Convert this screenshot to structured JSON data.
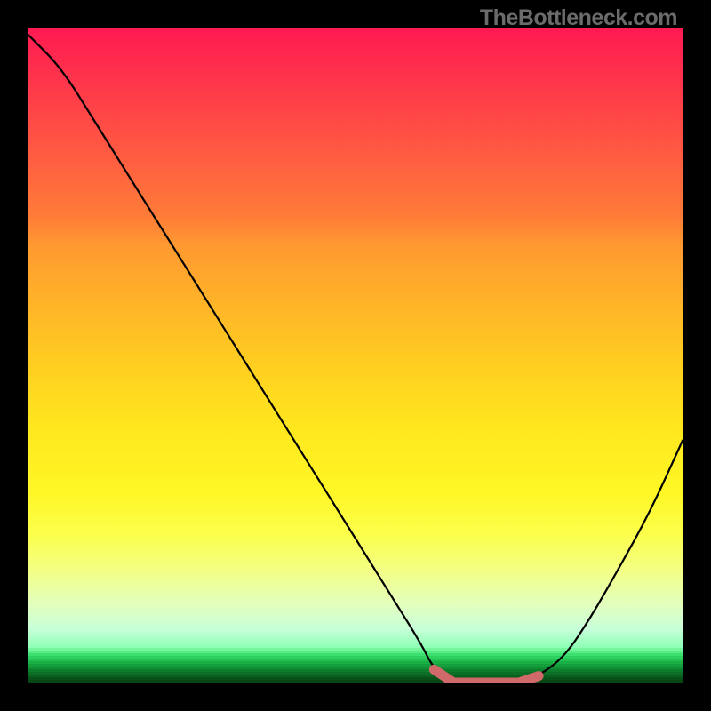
{
  "watermark": "TheBottleneck.com",
  "chart_data": {
    "type": "line",
    "title": "",
    "xlabel": "",
    "ylabel": "",
    "xlim": [
      0,
      100
    ],
    "ylim": [
      0,
      100
    ],
    "x": [
      0,
      5,
      10,
      15,
      20,
      25,
      30,
      35,
      40,
      45,
      50,
      55,
      60,
      62,
      65,
      68,
      72,
      75,
      78,
      82,
      86,
      90,
      95,
      100
    ],
    "values": [
      99,
      94,
      86,
      78,
      70,
      62,
      54,
      46,
      38,
      30,
      22,
      14,
      6,
      2,
      0,
      0,
      0,
      0,
      1,
      4,
      10,
      17,
      26,
      37
    ],
    "highlight_region": {
      "x_start": 62,
      "x_end": 78,
      "color": "#d06a6a"
    },
    "gradient_stops": [
      {
        "pos": 0,
        "color": "#ff1a52"
      },
      {
        "pos": 35,
        "color": "#ff9930"
      },
      {
        "pos": 65,
        "color": "#ffe81e"
      },
      {
        "pos": 88,
        "color": "#f2ff8a"
      },
      {
        "pos": 100,
        "color": "#8cffb4"
      }
    ],
    "bottom_stripes": [
      "#74f79c",
      "#55ed83",
      "#3de070",
      "#2ed160",
      "#22c152",
      "#1ab046",
      "#149f3c",
      "#108e33",
      "#0d7e2b",
      "#0b6f25",
      "#09601f",
      "#085219",
      "#064514"
    ]
  }
}
